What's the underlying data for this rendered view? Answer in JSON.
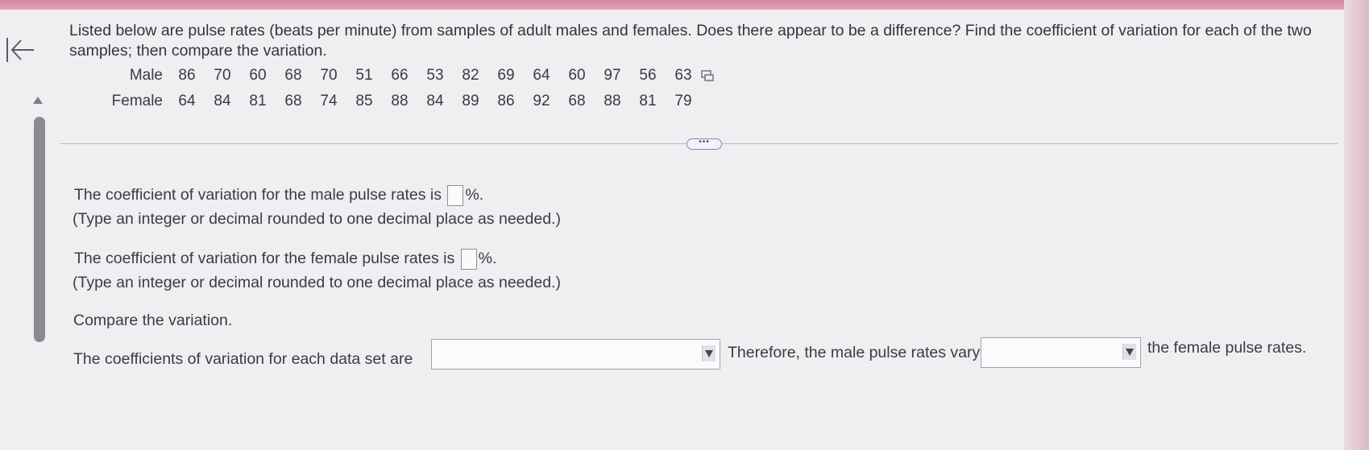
{
  "question": {
    "text": "Listed below are pulse rates (beats per minute) from samples of adult males and females. Does there appear to be a difference? Find the coefficient of variation for each of the two samples; then compare the variation."
  },
  "data_table": {
    "rows": [
      {
        "label": "Male",
        "values": [
          "86",
          "70",
          "60",
          "68",
          "70",
          "51",
          "66",
          "53",
          "82",
          "69",
          "64",
          "60",
          "97",
          "56",
          "63"
        ]
      },
      {
        "label": "Female",
        "values": [
          "64",
          "84",
          "81",
          "68",
          "74",
          "85",
          "88",
          "84",
          "89",
          "86",
          "92",
          "68",
          "88",
          "81",
          "79"
        ]
      }
    ]
  },
  "more_button": {
    "label": "•••"
  },
  "part1": {
    "prompt": "The coefficient of variation for the male pulse rates is",
    "unit": "%.",
    "hint": "(Type an integer or decimal rounded to one decimal place as needed.)"
  },
  "part2": {
    "prompt": "The coefficient of variation for the female pulse rates is",
    "unit": "%.",
    "hint": "(Type an integer or decimal rounded to one decimal place as needed.)"
  },
  "compare": {
    "heading": "Compare the variation.",
    "prefix": "The coefficients of variation for each data set are",
    "middle": "Therefore, the male pulse rates vary",
    "suffix": "the female pulse rates."
  },
  "colors": {
    "accent_band": "#d58aa0",
    "scrollbar": "#8a8a92"
  },
  "icons": {
    "back": "arrow-left-bar-icon",
    "copy": "copy-data-icon",
    "dropdown": "chevron-down-icon"
  }
}
